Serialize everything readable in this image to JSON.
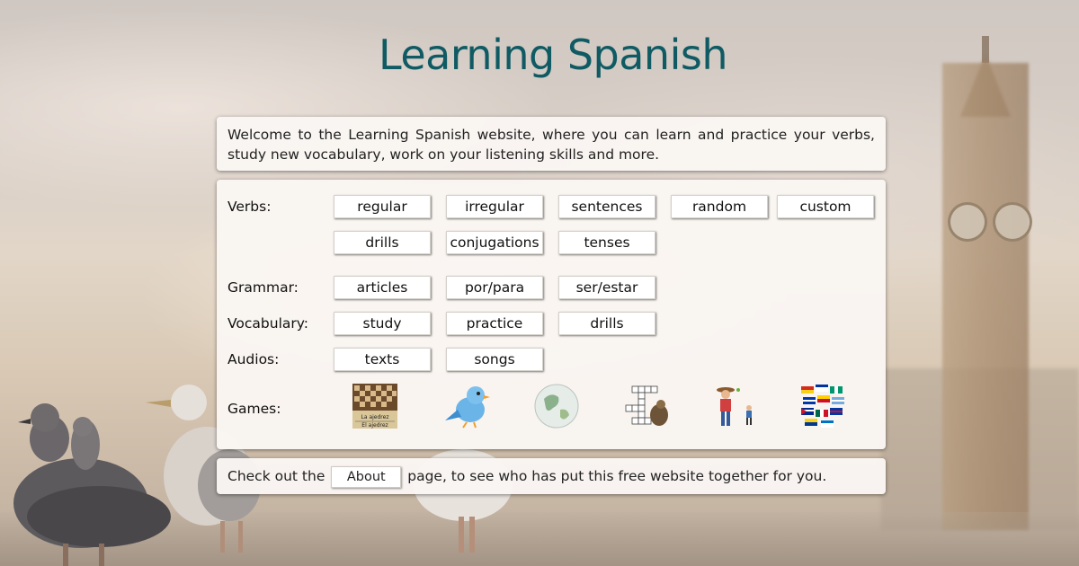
{
  "title": "Learning Spanish",
  "welcome_text": "Welcome to the Learning Spanish website, where you can learn and practice your verbs, study new vocabulary, work on your listening skills and more.",
  "sections": {
    "verbs": {
      "label": "Verbs:",
      "buttons": [
        "regular",
        "irregular",
        "sentences",
        "random",
        "custom",
        "drills",
        "conjugations",
        "tenses"
      ]
    },
    "grammar": {
      "label": "Grammar:",
      "buttons": [
        "articles",
        "por/para",
        "ser/estar"
      ]
    },
    "vocabulary": {
      "label": "Vocabulary:",
      "buttons": [
        "study",
        "practice",
        "drills"
      ]
    },
    "audios": {
      "label": "Audios:",
      "buttons": [
        "texts",
        "songs"
      ]
    },
    "games": {
      "label": "Games:",
      "items": [
        {
          "icon": "chess-board-icon",
          "caption1": "La ajedrez",
          "caption2": "El ajedrez"
        },
        {
          "icon": "bird-icon"
        },
        {
          "icon": "globe-icon"
        },
        {
          "icon": "crossword-icon"
        },
        {
          "icon": "hangman-icon"
        },
        {
          "icon": "flags-icon"
        }
      ]
    }
  },
  "footer": {
    "before": "Check out the",
    "button": "About",
    "after": "page, to see who has put this free website together for you."
  },
  "colors": {
    "title": "#0f5a63",
    "card_bg": "#faf6f2"
  }
}
